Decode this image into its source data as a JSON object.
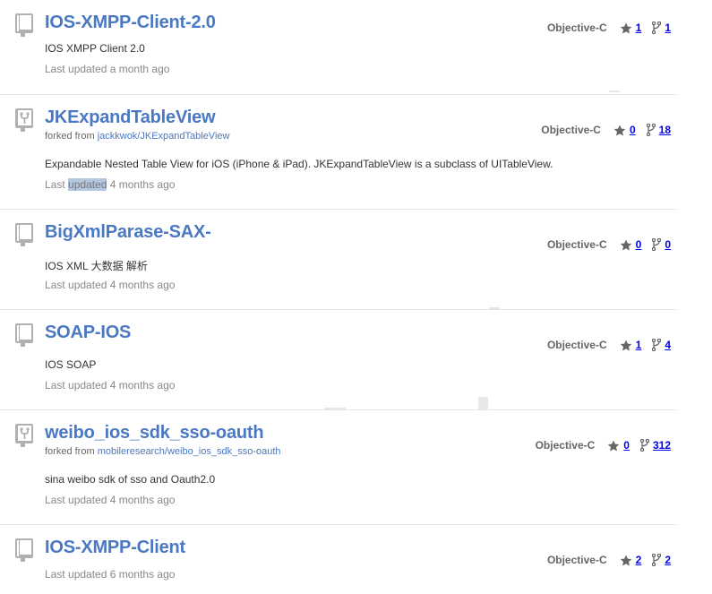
{
  "repos": [
    {
      "name": "IOS-XMPP-Client-2.0",
      "fork": false,
      "description": "IOS XMPP Client 2.0",
      "updated_prefix": "Last ",
      "updated_highlight": "updated",
      "updated_suffix": " a month ago",
      "language": "Objective-C",
      "stars": "1",
      "forks": "1"
    },
    {
      "name": "JKExpandTableView",
      "fork": true,
      "forked_label": "forked from ",
      "forked_from": "jackkwok/JKExpandTableView",
      "description": "Expandable Nested Table View for iOS (iPhone & iPad). JKExpandTableView is a subclass of UITableView.",
      "updated_prefix": "Last ",
      "updated_highlight": "updated",
      "updated_suffix": " 4 months ago",
      "language": "Objective-C",
      "stars": "0",
      "forks": "18"
    },
    {
      "name": "BigXmlParase-SAX-",
      "fork": false,
      "description": "IOS XML 大数据 解析",
      "updated_prefix": "Last ",
      "updated_highlight": "updated",
      "updated_suffix": " 4 months ago",
      "language": "Objective-C",
      "stars": "0",
      "forks": "0"
    },
    {
      "name": "SOAP-IOS",
      "fork": false,
      "description": "IOS SOAP",
      "updated_prefix": "Last ",
      "updated_highlight": "updated",
      "updated_suffix": " 4 months ago",
      "language": "Objective-C",
      "stars": "1",
      "forks": "4"
    },
    {
      "name": "weibo_ios_sdk_sso-oauth",
      "fork": true,
      "forked_label": "forked from ",
      "forked_from": "mobileresearch/weibo_ios_sdk_sso-oauth",
      "description": "sina weibo sdk of sso and Oauth2.0",
      "updated_prefix": "Last ",
      "updated_highlight": "updated",
      "updated_suffix": " 4 months ago",
      "language": "Objective-C",
      "stars": "0",
      "forks": "312"
    },
    {
      "name": "IOS-XMPP-Client",
      "fork": false,
      "description": "",
      "updated_prefix": "Last ",
      "updated_highlight": "updated",
      "updated_suffix": " 6 months ago",
      "language": "Objective-C",
      "stars": "2",
      "forks": "2"
    }
  ],
  "colors": {
    "link": "#4a78c3",
    "muted": "#888888",
    "highlight": "#b4c7e0",
    "icon": "#b0b0b0"
  },
  "icons": {
    "repo": "book-icon",
    "fork": "fork-icon",
    "star": "star-icon"
  }
}
